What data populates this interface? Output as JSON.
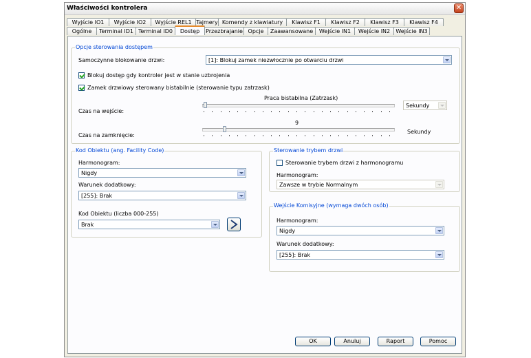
{
  "window": {
    "title": "Właściwości kontrolera"
  },
  "tabs_row1": [
    "Wyjście IO1",
    "Wyjście IO2",
    "Wyjście REL1",
    "Tajmery",
    "Komendy z klawiatury",
    "Klawisz F1",
    "Klawisz F2",
    "Klawisz F3",
    "Klawisz F4"
  ],
  "tabs_row2": [
    "Ogólne",
    "Terminal ID1",
    "Terminal ID0",
    "Dostęp",
    "Przezbrajanie",
    "Opcje",
    "Zaawansowane",
    "Wejście IN1",
    "Wejście IN2",
    "Wejście IN3"
  ],
  "active_tab": "Dostęp",
  "access": {
    "legend": "Opcje sterowania dostępem",
    "autolock_label": "Samoczynne blokowanie drzwi:",
    "autolock_value": "[1]: Blokuj zamek niezwłocznie po otwarciu drzwi",
    "block_armed": {
      "label": "Blokuj dostęp gdy kontroler jest w stanie uzbrojenia",
      "checked": true
    },
    "bistable": {
      "label": "Zamek drzwiowy sterowany bistabilnie (sterowanie typu zatrzask)",
      "checked": true
    },
    "slider_caption": "Praca bistabilna (Zatrzask)",
    "entry_label": "Czas na wejście:",
    "entry_unit": "Sekundy",
    "close_label": "Czas na zamknięcie:",
    "close_value": "9",
    "close_unit": "Sekundy"
  },
  "facility": {
    "legend": "Kod Obiektu (ang. Facility Code)",
    "schedule_label": "Harmonogram:",
    "schedule_value": "Nigdy",
    "condition_label": "Warunek dodatkowy:",
    "condition_value": "[255]: Brak",
    "code_label": "Kod Obiektu (liczba 000-255)",
    "code_value": "Brak"
  },
  "door_mode": {
    "legend": "Sterowanie trybem drzwi",
    "schedule_cb_label": "Sterowanie trybem drzwi z harmonogramu",
    "schedule_cb_checked": false,
    "schedule_label": "Harmonogram:",
    "schedule_value": "Zawsze w trybie Normalnym"
  },
  "commission": {
    "legend": "Wejście Komisyjne (wymaga dwóch osób)",
    "schedule_label": "Harmonogram:",
    "schedule_value": "Nigdy",
    "condition_label": "Warunek dodatkowy:",
    "condition_value": "[255]: Brak"
  },
  "buttons": {
    "ok": "OK",
    "cancel": "Anuluj",
    "report": "Raport",
    "help": "Pomoc"
  }
}
